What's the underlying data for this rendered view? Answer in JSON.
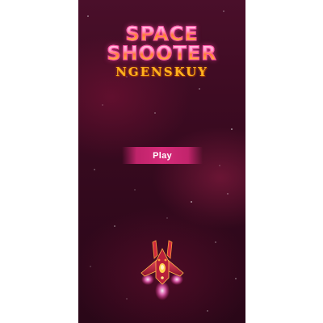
{
  "game": {
    "title_line1": "SPACE",
    "title_line2": "SHOOTER",
    "subtitle": "NGENSKUY"
  },
  "menu": {
    "play_label": "Play"
  },
  "player": {
    "ship_icon": "spaceship-icon"
  },
  "colors": {
    "background": "#3d0b22",
    "accent_pink": "#d62a79",
    "title_orange": "#ffb21e"
  }
}
